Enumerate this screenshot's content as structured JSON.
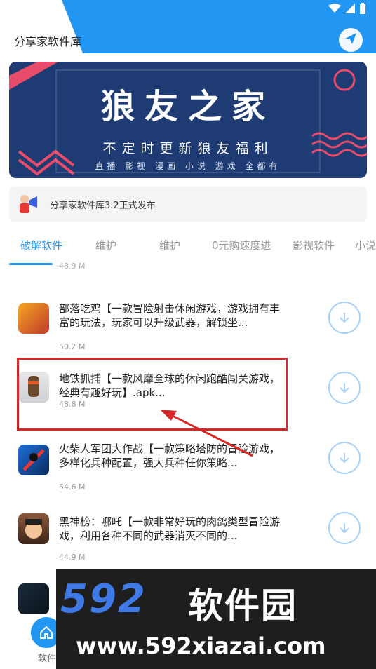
{
  "app": {
    "title": "分享家软件库"
  },
  "status_bar": {
    "icons": [
      "wifi-icon",
      "signal-icon",
      "battery-icon"
    ]
  },
  "header": {
    "send_icon": "send-icon"
  },
  "banner": {
    "title": "狼友之家",
    "subtitle": "不定时更新狼友福利",
    "tags": "直播 影视 漫画 小说 游戏 全都有"
  },
  "notice": {
    "text": "分享家软件库3.2正式发布"
  },
  "tabs": [
    {
      "label": "破解软件",
      "active": true
    },
    {
      "label": "维护"
    },
    {
      "label": "维护"
    },
    {
      "label": "0元购速度进"
    },
    {
      "label": "影视软件"
    },
    {
      "label": "小说"
    }
  ],
  "list": {
    "peek_size": "48.9 M",
    "items": [
      {
        "name": "部落吃鸡【一款冒险射击休闲游戏，游戏拥有丰富的玩法，玩家可以升级武器，解锁坐...",
        "size": "50.2 M"
      },
      {
        "name": "地铁抓捕【一款风靡全球的休闲跑酷闯关游戏，经典有趣好玩】.apk...",
        "size": "48.8 M"
      },
      {
        "name": "火柴人军团大作战【一款策略塔防的冒险游戏，多样化兵种配置，强大兵种任你策略...",
        "size": "54.6 M"
      },
      {
        "name": "黑神榜：哪吒【一款非常好玩的肉鸽类型冒险游戏，利用各种不同的武器消灭不同的...",
        "size": "44.9 M"
      }
    ]
  },
  "bottom_nav": {
    "home_label": "软件"
  },
  "watermark": {
    "logo": "592",
    "name": "软件园",
    "url": "www.592xiazai.com"
  },
  "colors": {
    "accent": "#2196f3",
    "highlight": "#d62828"
  }
}
